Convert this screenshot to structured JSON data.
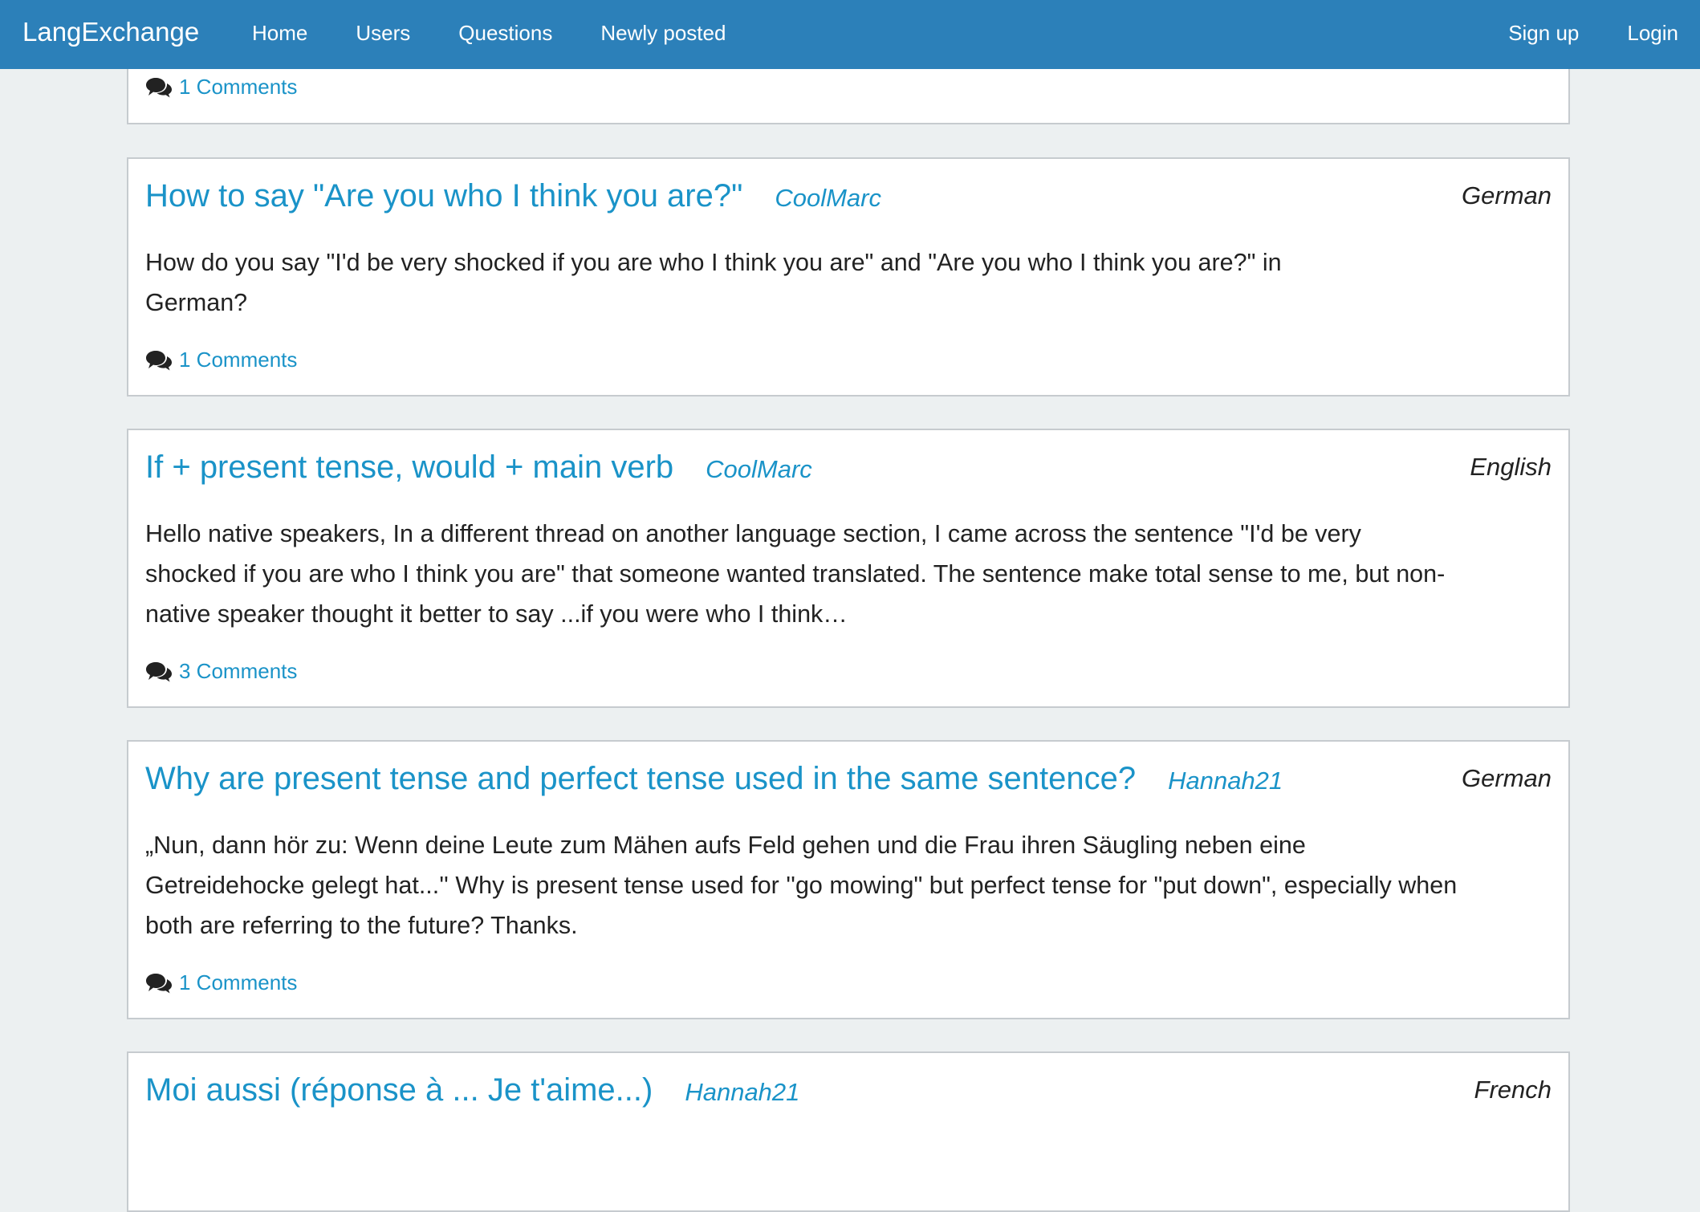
{
  "navbar": {
    "brand": "LangExchange",
    "links": [
      "Home",
      "Users",
      "Questions",
      "Newly posted"
    ],
    "right_links": [
      "Sign up",
      "Login"
    ],
    "color": "#2c80b9"
  },
  "accent_color": "#1a93c8",
  "icons": {
    "comments": "comments-icon"
  },
  "questions": [
    {
      "title": "",
      "author": "",
      "language": "",
      "body": "",
      "comments": "1 Comments"
    },
    {
      "title": "How to say \"Are you who I think you are?\"",
      "author": "CoolMarc",
      "language": "German",
      "body_lines": [
        "How do you say \"I'd be very shocked if you are who I think you are\" and \"Are you who I think you are?\" in",
        "German?"
      ],
      "comments": "1 Comments"
    },
    {
      "title": "If + present tense, would + main verb",
      "author": "CoolMarc",
      "language": "English",
      "body_lines": [
        "Hello native speakers, In a different thread on another language section, I came across the sentence \"I'd be very",
        "shocked if you are who I think you are\" that someone wanted translated. The sentence make total sense to me, but non-",
        "native speaker thought it better to say ...if you were who I think…"
      ],
      "comments": "3 Comments"
    },
    {
      "title": "Why are present tense and perfect tense used in the same sentence?",
      "author": "Hannah21",
      "language": "German",
      "body_lines": [
        "„Nun, dann hör zu: Wenn deine Leute zum Mähen aufs Feld gehen und die Frau ihren Säugling neben eine",
        "Getreidehocke gelegt hat...'' Why is present tense used for ''go mowing\" but perfect tense for \"put down\", especially when",
        "both are referring to the future? Thanks."
      ],
      "comments": "1 Comments"
    },
    {
      "title": "Moi aussi (réponse à ... Je t'aime...)",
      "author": "Hannah21",
      "language": "French"
    }
  ]
}
